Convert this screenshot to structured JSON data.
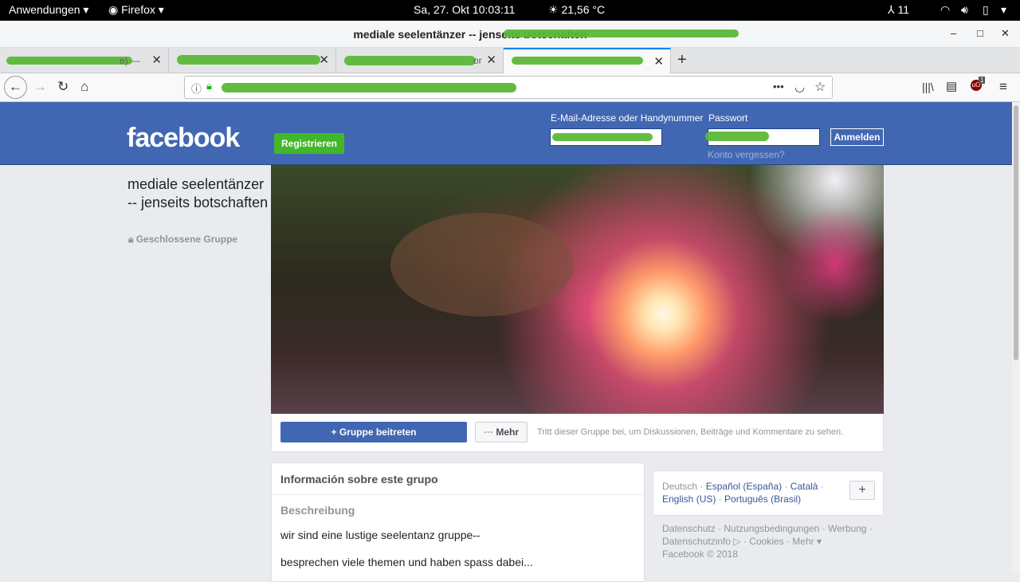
{
  "system_bar": {
    "apps_label": "Anwendungen ▾",
    "browser_label": "Firefox ▾",
    "datetime": "Sa, 27. Okt  10:03:11",
    "weather": "21,56 °C",
    "accessibility_count": "11"
  },
  "window": {
    "title": "mediale seelentänzer -- jenseits botschaften",
    "minimize": "–",
    "maximize": "□",
    "close": "✕"
  },
  "tabs": [
    {
      "title": "e) —"
    },
    {
      "title": ""
    },
    {
      "title": "or"
    },
    {
      "title": ""
    }
  ],
  "toolbar": {
    "new_tab": "+",
    "back": "←",
    "forward": "→",
    "reload": "↻",
    "home": "⌂",
    "page_actions": "•••",
    "addon_badge": "1"
  },
  "facebook": {
    "logo": "facebook",
    "register_label": "Registrieren",
    "email_label": "E-Mail-Adresse oder Handynummer",
    "password_label": "Passwort",
    "login_label": "Anmelden",
    "forgot_label": "Konto vergessen?"
  },
  "group": {
    "name": "mediale seelentänzer -- jenseits botschaften",
    "type": "Geschlossene Gruppe",
    "join_label": "Gruppe beitreten",
    "more_label": "Mehr",
    "join_hint": "Tritt dieser Gruppe bei, um Diskussionen, Beiträge und Kommentare zu sehen."
  },
  "info": {
    "title": "Información sobre este grupo",
    "description_label": "Beschreibung",
    "lines": [
      "wir sind eine lustige seelentanz gruppe--",
      "besprechen viele themen und haben spass dabei..."
    ]
  },
  "languages": {
    "current": "Deutsch",
    "others": [
      "Español (España)",
      "Català",
      "English (US)",
      "Português (Brasil)"
    ]
  },
  "footer": {
    "line1": "Datenschutz · Nutzungsbedingungen · Werbung ·",
    "line2": "Datenschutzinfo ▷ · Cookies · Mehr ▾",
    "line3": "Facebook © 2018"
  },
  "colors": {
    "facebook_blue": "#4267b2",
    "register_green": "#42b72a",
    "redaction_green": "#5bb837"
  }
}
